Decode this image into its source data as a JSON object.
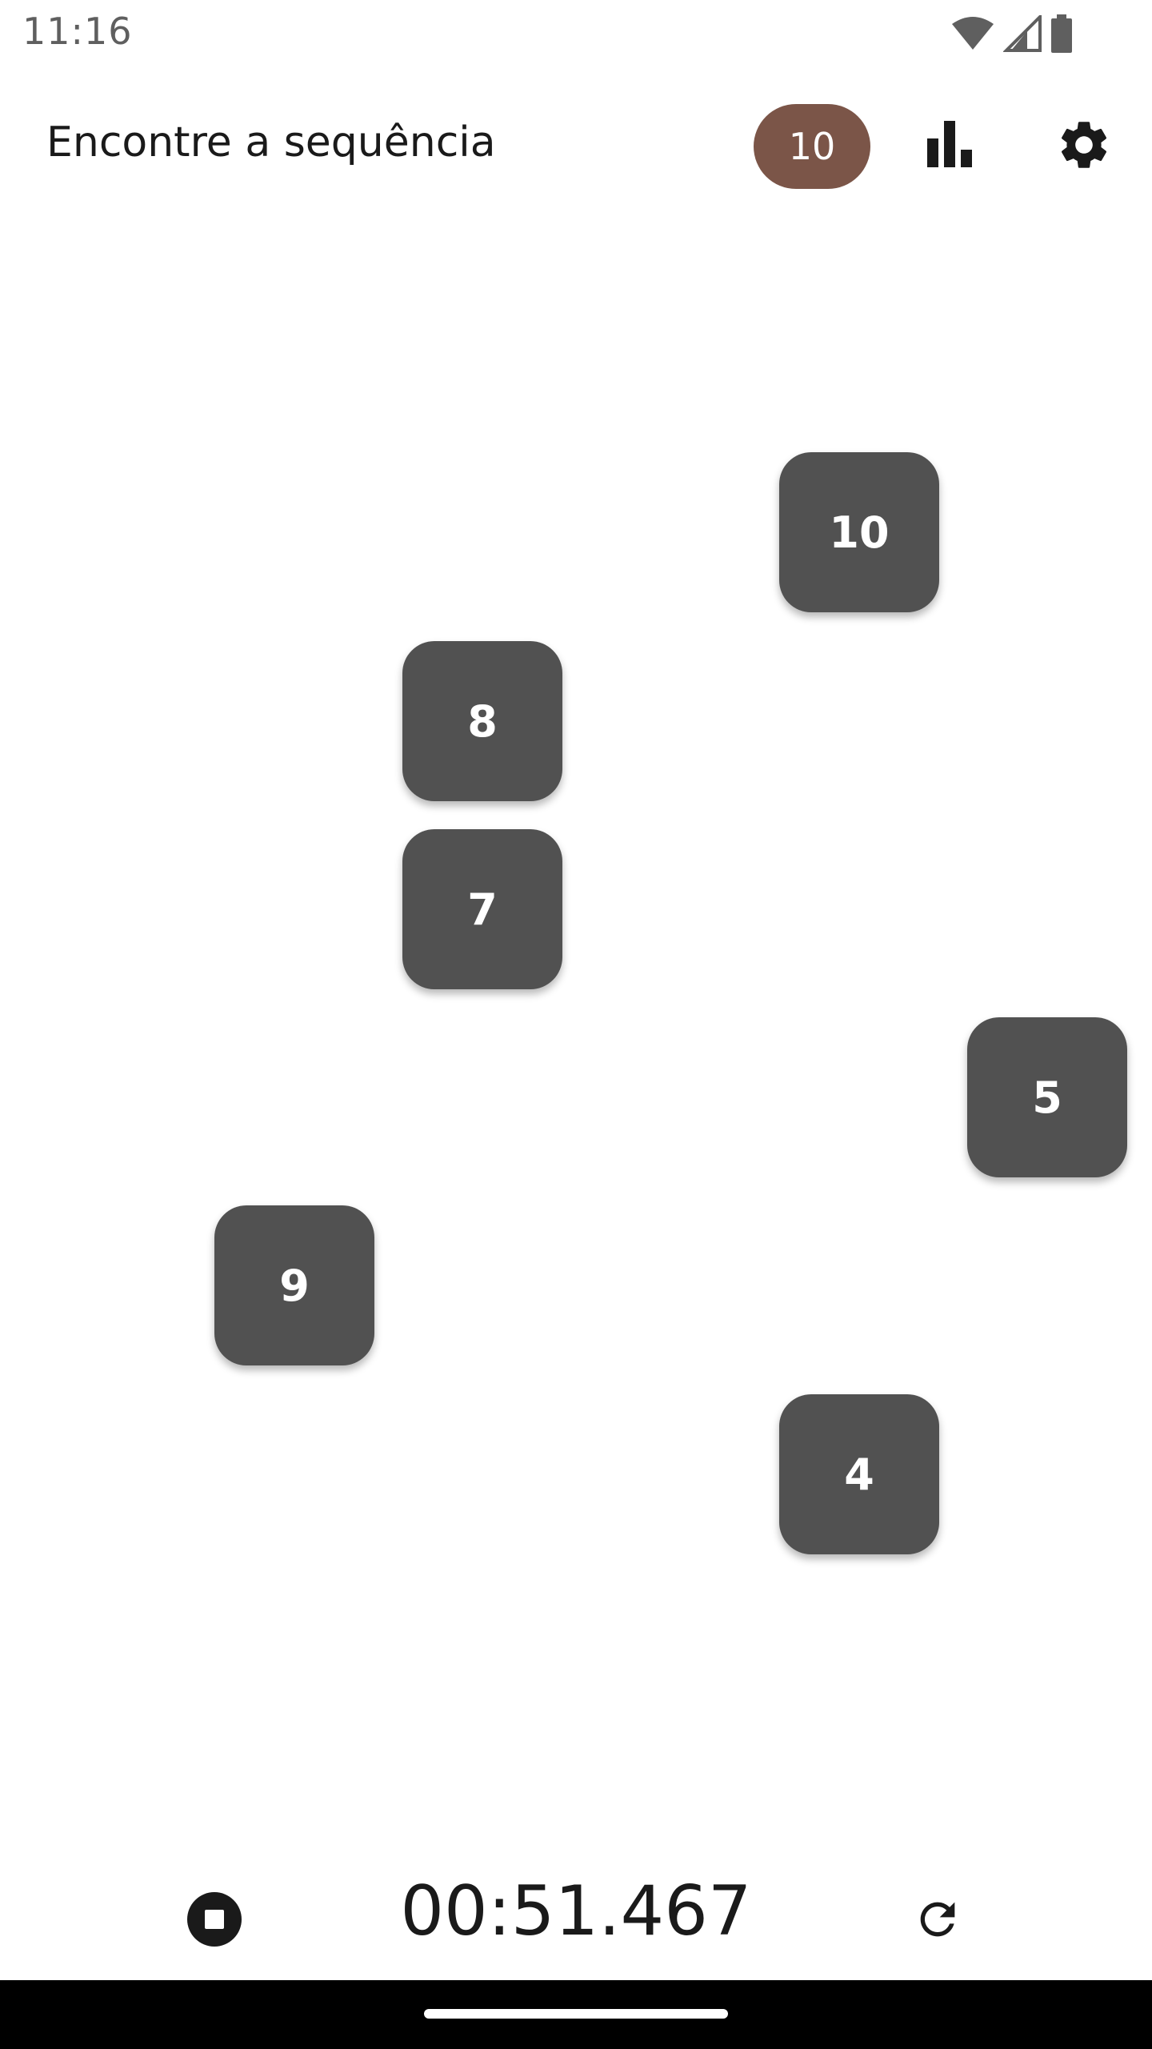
{
  "status_bar": {
    "time": "11:16",
    "icons": [
      "wifi-icon",
      "signal-icon",
      "battery-icon"
    ]
  },
  "app_bar": {
    "title": "Encontre a sequência",
    "level_badge": "10",
    "icons": [
      "bar-chart-icon",
      "gear-icon"
    ],
    "badge_color": "#7b5548"
  },
  "board": {
    "tiles": [
      {
        "label": "10"
      },
      {
        "label": "8"
      },
      {
        "label": "7"
      },
      {
        "label": "5"
      },
      {
        "label": "9"
      },
      {
        "label": "4"
      }
    ],
    "tile_color": "#515151"
  },
  "bottom_bar": {
    "timer": "00:51.467",
    "icons": [
      "stop-icon",
      "restart-icon"
    ]
  }
}
